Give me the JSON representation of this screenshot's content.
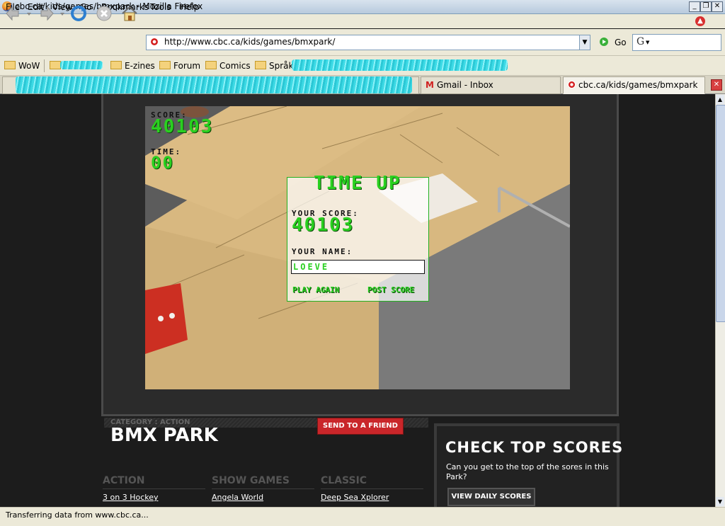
{
  "window": {
    "title": "cbc.ca/kids/games/bmxpark - Mozilla Firefox",
    "minimize_glyph": "_",
    "restore_glyph": "❐",
    "close_glyph": "✕"
  },
  "menus": [
    "File",
    "Edit",
    "View",
    "Go",
    "Bookmarks",
    "Tools",
    "Help"
  ],
  "toolbar": {
    "url": "http://www.cbc.ca/kids/games/bmxpark/",
    "go_label": "Go",
    "search_engine_glyph": "G"
  },
  "bookmarks": [
    "WoW",
    "E-zines",
    "Forum",
    "Comics",
    "Språk"
  ],
  "tabs": {
    "gmail": "Gmail - Inbox",
    "active": "cbc.ca/kids/games/bmxpark"
  },
  "game": {
    "score_label": "SCORE:",
    "score_value": "40103",
    "time_label": "TIME:",
    "time_value": "00",
    "dialog_title": "TIME UP",
    "your_score_label": "YOUR SCORE:",
    "your_score_value": "40103",
    "your_name_label": "YOUR NAME:",
    "name_value": "LOEVE",
    "play_again": "PLAY AGAIN",
    "post_score": "POST SCORE"
  },
  "page": {
    "category": "CATEGORY : ACTION",
    "game_title": "BMX PARK",
    "send_to_friend": "SEND TO A FRIEND",
    "columns": [
      {
        "head": "ACTION",
        "link": "3 on 3 Hockey"
      },
      {
        "head": "SHOW GAMES",
        "link": "Angela World"
      },
      {
        "head": "CLASSIC",
        "link": "Deep Sea Xplorer"
      }
    ],
    "top_scores_title": "CHECK TOP SCORES",
    "top_scores_desc": "Can you get to the top of the sores in this Park?",
    "view_daily": "VIEW DAILY SCORES"
  },
  "status": "Transferring data from www.cbc.ca..."
}
